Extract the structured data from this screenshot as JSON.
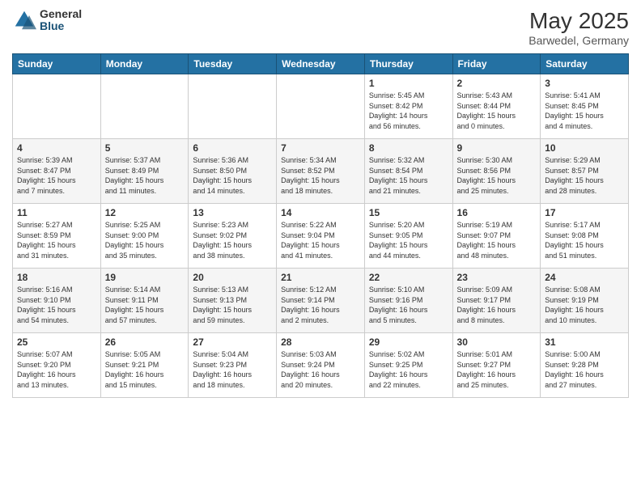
{
  "logo": {
    "general": "General",
    "blue": "Blue"
  },
  "title": {
    "month": "May 2025",
    "location": "Barwedel, Germany"
  },
  "weekdays": [
    "Sunday",
    "Monday",
    "Tuesday",
    "Wednesday",
    "Thursday",
    "Friday",
    "Saturday"
  ],
  "weeks": [
    [
      {
        "day": "",
        "info": ""
      },
      {
        "day": "",
        "info": ""
      },
      {
        "day": "",
        "info": ""
      },
      {
        "day": "",
        "info": ""
      },
      {
        "day": "1",
        "info": "Sunrise: 5:45 AM\nSunset: 8:42 PM\nDaylight: 14 hours\nand 56 minutes."
      },
      {
        "day": "2",
        "info": "Sunrise: 5:43 AM\nSunset: 8:44 PM\nDaylight: 15 hours\nand 0 minutes."
      },
      {
        "day": "3",
        "info": "Sunrise: 5:41 AM\nSunset: 8:45 PM\nDaylight: 15 hours\nand 4 minutes."
      }
    ],
    [
      {
        "day": "4",
        "info": "Sunrise: 5:39 AM\nSunset: 8:47 PM\nDaylight: 15 hours\nand 7 minutes."
      },
      {
        "day": "5",
        "info": "Sunrise: 5:37 AM\nSunset: 8:49 PM\nDaylight: 15 hours\nand 11 minutes."
      },
      {
        "day": "6",
        "info": "Sunrise: 5:36 AM\nSunset: 8:50 PM\nDaylight: 15 hours\nand 14 minutes."
      },
      {
        "day": "7",
        "info": "Sunrise: 5:34 AM\nSunset: 8:52 PM\nDaylight: 15 hours\nand 18 minutes."
      },
      {
        "day": "8",
        "info": "Sunrise: 5:32 AM\nSunset: 8:54 PM\nDaylight: 15 hours\nand 21 minutes."
      },
      {
        "day": "9",
        "info": "Sunrise: 5:30 AM\nSunset: 8:56 PM\nDaylight: 15 hours\nand 25 minutes."
      },
      {
        "day": "10",
        "info": "Sunrise: 5:29 AM\nSunset: 8:57 PM\nDaylight: 15 hours\nand 28 minutes."
      }
    ],
    [
      {
        "day": "11",
        "info": "Sunrise: 5:27 AM\nSunset: 8:59 PM\nDaylight: 15 hours\nand 31 minutes."
      },
      {
        "day": "12",
        "info": "Sunrise: 5:25 AM\nSunset: 9:00 PM\nDaylight: 15 hours\nand 35 minutes."
      },
      {
        "day": "13",
        "info": "Sunrise: 5:23 AM\nSunset: 9:02 PM\nDaylight: 15 hours\nand 38 minutes."
      },
      {
        "day": "14",
        "info": "Sunrise: 5:22 AM\nSunset: 9:04 PM\nDaylight: 15 hours\nand 41 minutes."
      },
      {
        "day": "15",
        "info": "Sunrise: 5:20 AM\nSunset: 9:05 PM\nDaylight: 15 hours\nand 44 minutes."
      },
      {
        "day": "16",
        "info": "Sunrise: 5:19 AM\nSunset: 9:07 PM\nDaylight: 15 hours\nand 48 minutes."
      },
      {
        "day": "17",
        "info": "Sunrise: 5:17 AM\nSunset: 9:08 PM\nDaylight: 15 hours\nand 51 minutes."
      }
    ],
    [
      {
        "day": "18",
        "info": "Sunrise: 5:16 AM\nSunset: 9:10 PM\nDaylight: 15 hours\nand 54 minutes."
      },
      {
        "day": "19",
        "info": "Sunrise: 5:14 AM\nSunset: 9:11 PM\nDaylight: 15 hours\nand 57 minutes."
      },
      {
        "day": "20",
        "info": "Sunrise: 5:13 AM\nSunset: 9:13 PM\nDaylight: 15 hours\nand 59 minutes."
      },
      {
        "day": "21",
        "info": "Sunrise: 5:12 AM\nSunset: 9:14 PM\nDaylight: 16 hours\nand 2 minutes."
      },
      {
        "day": "22",
        "info": "Sunrise: 5:10 AM\nSunset: 9:16 PM\nDaylight: 16 hours\nand 5 minutes."
      },
      {
        "day": "23",
        "info": "Sunrise: 5:09 AM\nSunset: 9:17 PM\nDaylight: 16 hours\nand 8 minutes."
      },
      {
        "day": "24",
        "info": "Sunrise: 5:08 AM\nSunset: 9:19 PM\nDaylight: 16 hours\nand 10 minutes."
      }
    ],
    [
      {
        "day": "25",
        "info": "Sunrise: 5:07 AM\nSunset: 9:20 PM\nDaylight: 16 hours\nand 13 minutes."
      },
      {
        "day": "26",
        "info": "Sunrise: 5:05 AM\nSunset: 9:21 PM\nDaylight: 16 hours\nand 15 minutes."
      },
      {
        "day": "27",
        "info": "Sunrise: 5:04 AM\nSunset: 9:23 PM\nDaylight: 16 hours\nand 18 minutes."
      },
      {
        "day": "28",
        "info": "Sunrise: 5:03 AM\nSunset: 9:24 PM\nDaylight: 16 hours\nand 20 minutes."
      },
      {
        "day": "29",
        "info": "Sunrise: 5:02 AM\nSunset: 9:25 PM\nDaylight: 16 hours\nand 22 minutes."
      },
      {
        "day": "30",
        "info": "Sunrise: 5:01 AM\nSunset: 9:27 PM\nDaylight: 16 hours\nand 25 minutes."
      },
      {
        "day": "31",
        "info": "Sunrise: 5:00 AM\nSunset: 9:28 PM\nDaylight: 16 hours\nand 27 minutes."
      }
    ]
  ]
}
